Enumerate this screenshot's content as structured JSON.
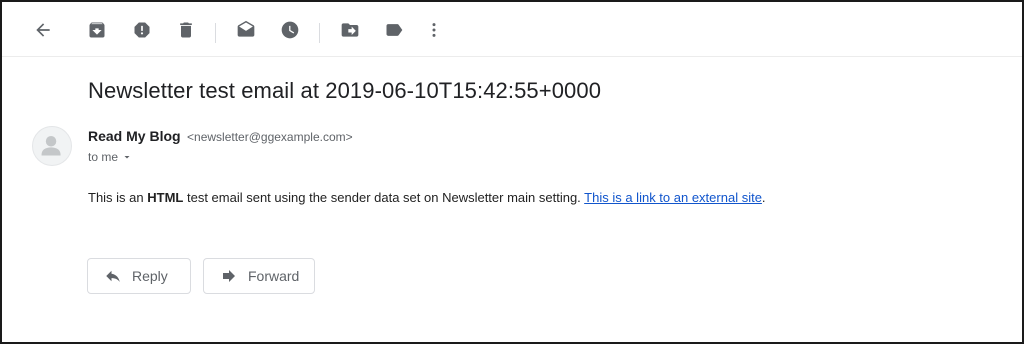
{
  "toolbar": {
    "buttons": [
      {
        "name": "back",
        "icon": "back-arrow-icon"
      },
      {
        "name": "archive",
        "icon": "archive-icon"
      },
      {
        "name": "report-spam",
        "icon": "report-spam-icon"
      },
      {
        "name": "delete",
        "icon": "trash-icon"
      },
      {
        "name": "mark-unread",
        "icon": "mark-unread-icon"
      },
      {
        "name": "snooze",
        "icon": "clock-icon"
      },
      {
        "name": "move-to",
        "icon": "move-to-icon"
      },
      {
        "name": "labels",
        "icon": "label-icon"
      },
      {
        "name": "more",
        "icon": "more-vert-icon"
      }
    ]
  },
  "email": {
    "subject": "Newsletter test email at 2019-06-10T15:42:55+0000",
    "sender_name": "Read My Blog",
    "sender_email": "<newsletter@ggexample.com>",
    "recipient_label": "to me",
    "body": {
      "prefix": "This is an ",
      "bold": "HTML",
      "middle": " test email sent using the sender data set on Newsletter main setting. ",
      "link_text": "This is a link to an external site",
      "suffix": "."
    }
  },
  "actions": {
    "reply_label": "Reply",
    "forward_label": "Forward"
  },
  "colors": {
    "icon": "#5f6368",
    "link": "#1155cc",
    "border": "#dadce0"
  }
}
